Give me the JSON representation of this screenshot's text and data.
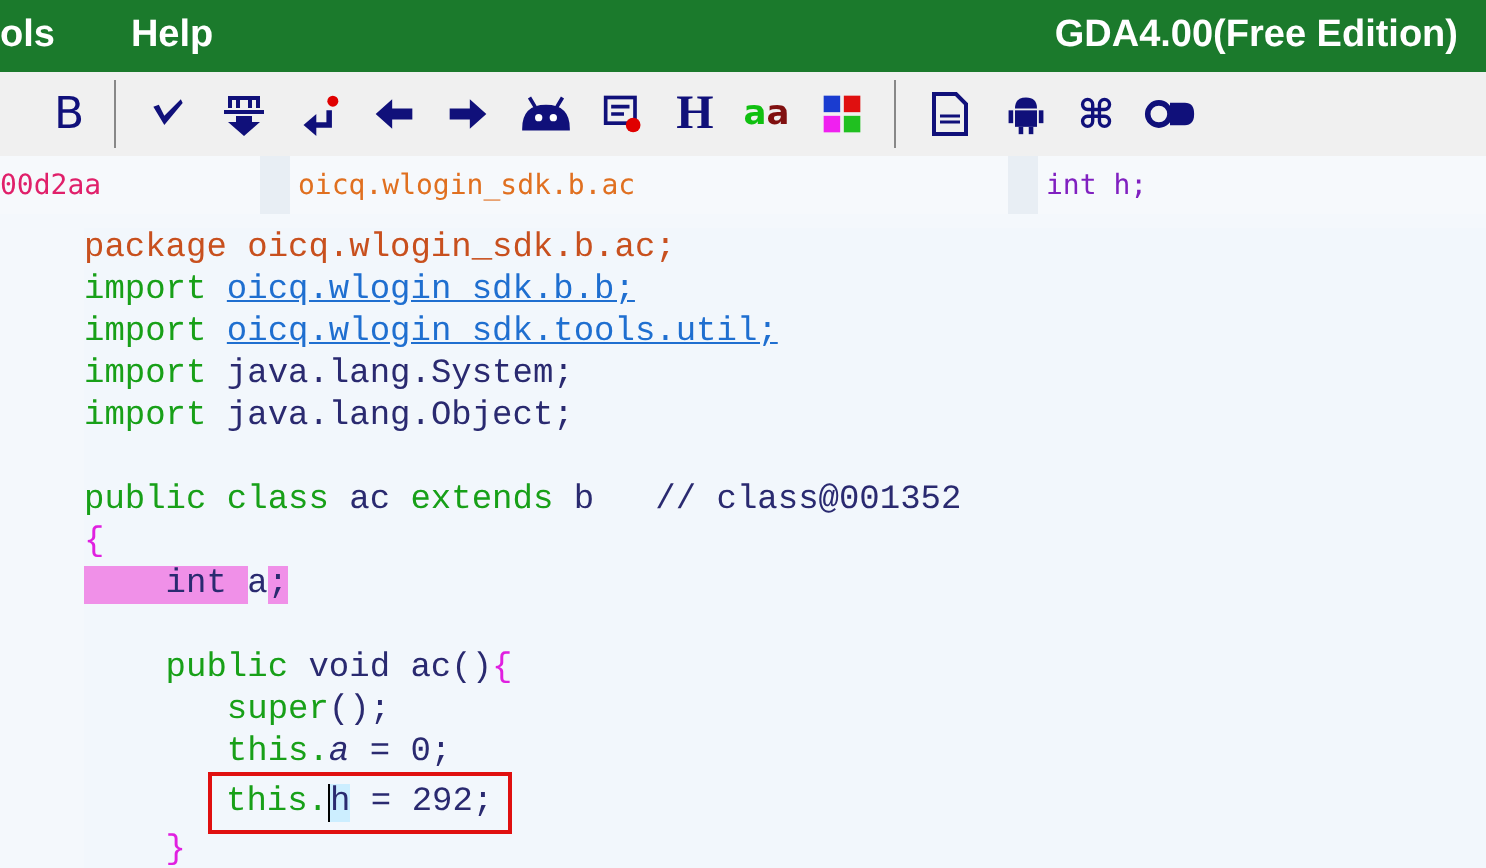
{
  "menu_bar": {
    "items": [
      "ols",
      "Help"
    ],
    "title": "GDA4.00(Free Edition)"
  },
  "toolbar": {
    "bold": "B",
    "heading": "H",
    "case_letters": [
      "a",
      "a"
    ],
    "command": "⌘"
  },
  "location_bar": {
    "address": "00d2aa",
    "class_path": "oicq.wlogin_sdk.b.ac",
    "member": "int h;"
  },
  "code": [
    {
      "segments": [
        {
          "kind": "package",
          "text": "package oicq.wlogin_sdk.b.ac;"
        }
      ]
    },
    {
      "segments": [
        {
          "kind": "keyword",
          "text": "import "
        },
        {
          "kind": "link",
          "text": "oicq.wlogin sdk.b.b;"
        }
      ]
    },
    {
      "segments": [
        {
          "kind": "keyword",
          "text": "import "
        },
        {
          "kind": "link",
          "text": "oicq.wlogin sdk.tools.util;"
        }
      ]
    },
    {
      "segments": [
        {
          "kind": "keyword",
          "text": "import "
        },
        {
          "kind": "ident",
          "text": "java.lang.System;"
        }
      ]
    },
    {
      "segments": [
        {
          "kind": "keyword",
          "text": "import "
        },
        {
          "kind": "ident",
          "text": "java.lang.Object;"
        }
      ]
    },
    {
      "kind": "blank"
    },
    {
      "segments": [
        {
          "kind": "keyword",
          "text": "public class "
        },
        {
          "kind": "ident",
          "text": "ac "
        },
        {
          "kind": "keyword",
          "text": "extends "
        },
        {
          "kind": "ident",
          "text": "b   // class@001352"
        }
      ]
    },
    {
      "segments": [
        {
          "kind": "brace",
          "text": "{"
        }
      ]
    },
    {
      "segments": [
        {
          "kind": "ident",
          "text": "    int ",
          "highlighted": true
        },
        {
          "kind": "ident",
          "text": "a"
        },
        {
          "kind": "ident",
          "text": ";",
          "highlighted": true
        }
      ]
    },
    {
      "kind": "blank"
    },
    {
      "segments": [
        {
          "kind": "keyword",
          "text": "    public "
        },
        {
          "kind": "ident",
          "text": "void ac()"
        },
        {
          "kind": "brace",
          "text": "{"
        }
      ]
    },
    {
      "segments": [
        {
          "kind": "keyword",
          "text": "       super"
        },
        {
          "kind": "ident",
          "text": "();"
        }
      ]
    },
    {
      "segments": [
        {
          "kind": "keyword",
          "text": "       this."
        },
        {
          "kind": "field",
          "text": "a"
        },
        {
          "kind": "ident",
          "text": " = 0;"
        }
      ]
    },
    {
      "segments": [
        {
          "kind": "keyword",
          "text": "this."
        },
        {
          "kind": "cursor",
          "text": "h"
        },
        {
          "kind": "ident",
          "text": " = 292;"
        }
      ],
      "boxed": true
    },
    {
      "segments": [
        {
          "kind": "brace",
          "text": "    }"
        }
      ]
    }
  ]
}
